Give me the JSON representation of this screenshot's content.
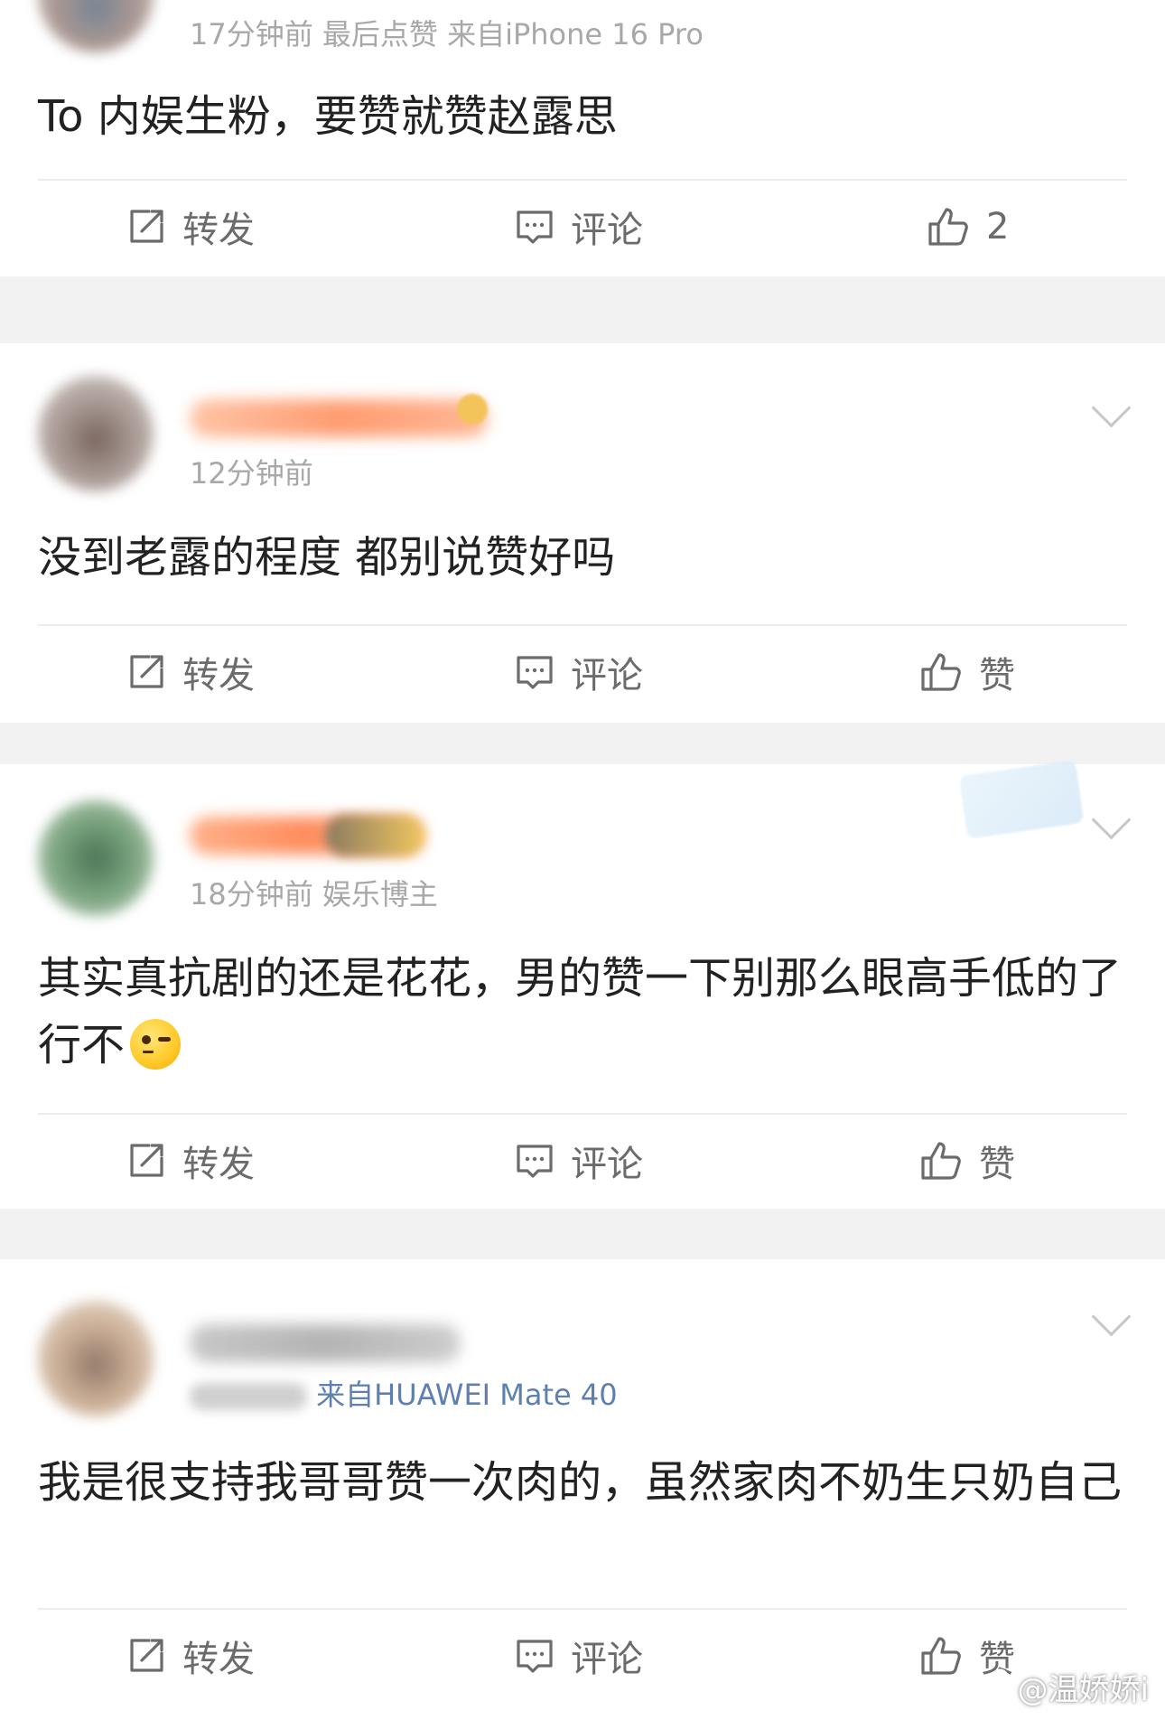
{
  "colors": {
    "background": "#f2f2f2",
    "card": "#ffffff",
    "text_primary": "#222222",
    "text_meta": "#a8a8a8",
    "action_text": "#6b6b6b",
    "source_link": "#5d80b0"
  },
  "actions": {
    "repost_label": "转发",
    "comment_label": "评论",
    "like_label": "赞"
  },
  "posts": [
    {
      "meta": "17分钟前  最后点赞  来自iPhone 16 Pro",
      "content": "To 内娱生粉，要赞就赞赵露思",
      "like_count": "2"
    },
    {
      "meta": "12分钟前",
      "content": "没到老露的程度 都别说赞好吗"
    },
    {
      "meta": "18分钟前  娱乐博主",
      "content": "其实真抗剧的还是花花，男的赞一下别那么眼高手低的了行不"
    },
    {
      "meta_source": "来自HUAWEI Mate 40",
      "content": "我是很支持我哥哥赞一次肉的，虽然家肉不奶生只奶自己"
    }
  ],
  "watermark": {
    "text": "@温娇娇i",
    "icon": "weibo-icon"
  }
}
